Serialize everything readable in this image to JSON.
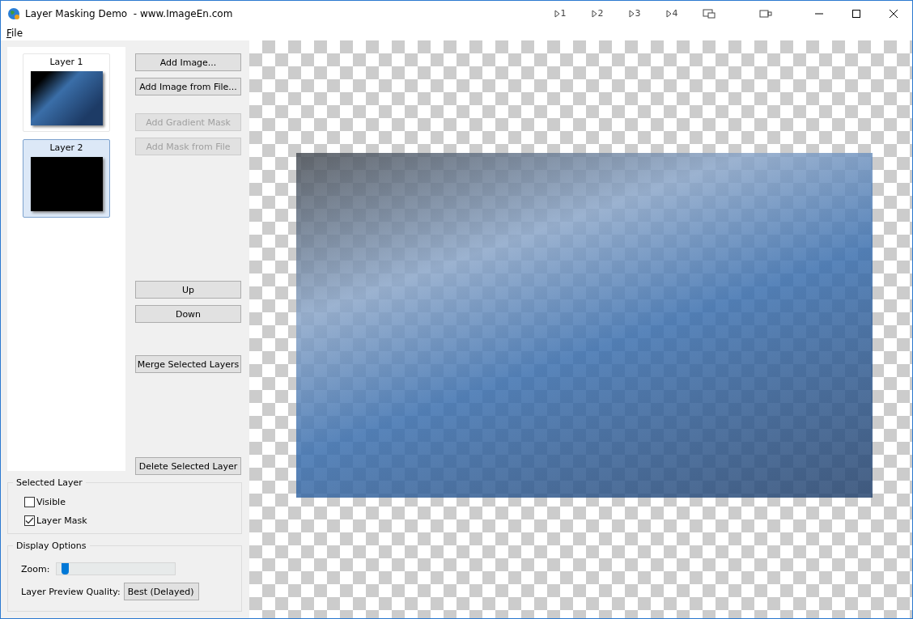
{
  "window": {
    "title": "Layer Masking Demo  - www.ImageEn.com",
    "caption_buttons": [
      "1",
      "2",
      "3",
      "4"
    ]
  },
  "menu": [
    {
      "label": "File"
    }
  ],
  "layers": [
    {
      "label": "Layer 1",
      "selected": false
    },
    {
      "label": "Layer 2",
      "selected": true
    }
  ],
  "button_groups": [
    [
      {
        "label": "Add Image...",
        "disabled": false
      },
      {
        "label": "Add Image from File...",
        "disabled": false
      }
    ],
    [
      {
        "label": "Add Gradient Mask",
        "disabled": true
      },
      {
        "label": "Add Mask from File",
        "disabled": true
      }
    ],
    [
      {
        "label": "Up",
        "disabled": false
      },
      {
        "label": "Down",
        "disabled": false
      }
    ],
    [
      {
        "label": "Merge Selected Layers",
        "disabled": false
      }
    ],
    [
      {
        "label": "Delete Selected Layer",
        "disabled": false
      }
    ]
  ],
  "selected_layer": {
    "title": "Selected Layer",
    "options": [
      {
        "label": "Visible",
        "checked": false
      },
      {
        "label": "Layer Mask",
        "checked": true
      }
    ]
  },
  "display_options": {
    "title": "Display Options",
    "zoom_label": "Zoom:",
    "zoom": {
      "level": 0.04
    },
    "quality_label": "Layer Preview Quality:",
    "quality_value": "Best (Delayed)"
  }
}
